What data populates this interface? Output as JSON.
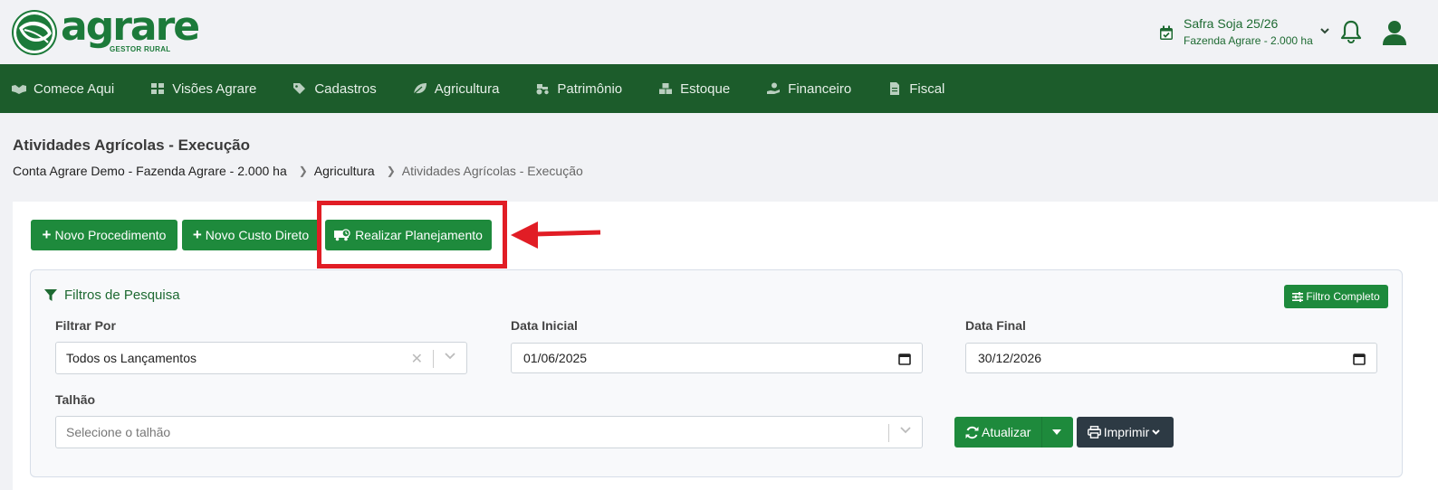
{
  "brand": {
    "name": "agrare",
    "subtitle": "GESTOR RURAL",
    "color": "#1c7a3a"
  },
  "season": {
    "title": "Safra Soja 25/26",
    "farm": "Fazenda Agrare - 2.000 ha"
  },
  "nav": [
    {
      "label": "Comece Aqui",
      "icon": "handshake-icon"
    },
    {
      "label": "Visões Agrare",
      "icon": "dashboard-icon"
    },
    {
      "label": "Cadastros",
      "icon": "tags-icon"
    },
    {
      "label": "Agricultura",
      "icon": "leaf-icon"
    },
    {
      "label": "Patrimônio",
      "icon": "tractor-icon"
    },
    {
      "label": "Estoque",
      "icon": "boxes-icon"
    },
    {
      "label": "Financeiro",
      "icon": "hand-coin-icon"
    },
    {
      "label": "Fiscal",
      "icon": "file-invoice-icon"
    }
  ],
  "page": {
    "title": "Atividades Agrícolas - Execução",
    "breadcrumb": [
      "Conta Agrare Demo - Fazenda Agrare - 2.000 ha",
      "Agricultura",
      "Atividades Agrícolas - Execução"
    ]
  },
  "actions": {
    "novo_procedimento": "Novo Procedimento",
    "novo_custo_direto": "Novo Custo Direto",
    "realizar_planejamento": "Realizar Planejamento"
  },
  "filters": {
    "title": "Filtros de Pesquisa",
    "filtro_completo": "Filtro Completo",
    "filtrar_por_label": "Filtrar Por",
    "filtrar_por_value": "Todos os Lançamentos",
    "data_inicial_label": "Data Inicial",
    "data_inicial_value": "01/06/2025",
    "data_final_label": "Data Final",
    "data_final_value": "30/12/2026",
    "talhao_label": "Talhão",
    "talhao_placeholder": "Selecione o talhão",
    "atualizar": "Atualizar",
    "imprimir": "Imprimir"
  },
  "colors": {
    "nav_bg": "#1c5c2b",
    "accent": "#1e8a3c",
    "highlight": "#e11d25",
    "dark_button": "#2d3a44"
  }
}
